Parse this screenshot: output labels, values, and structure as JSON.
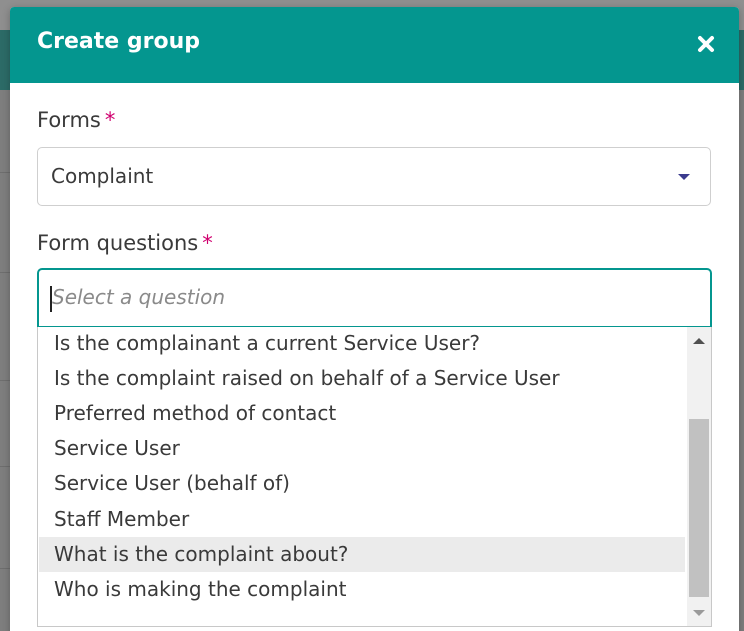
{
  "modal": {
    "title": "Create group",
    "close_icon": "close-icon"
  },
  "forms": {
    "label": "Forms",
    "required_marker": "*",
    "selected_value": "Complaint"
  },
  "form_questions": {
    "label": "Form questions",
    "required_marker": "*",
    "placeholder": "Select a question",
    "options": [
      "Is the complainant a current Service User?",
      "Is the complaint raised on behalf of a Service User",
      "Preferred method of contact",
      "Service User",
      "Service User (behalf of)",
      "Staff Member",
      "What is the complaint about?",
      "Who is making the complaint"
    ],
    "hovered_option": "What is the complaint about?"
  },
  "colors": {
    "header": "#04968f",
    "focus_border": "#04968f",
    "required": "#d0006f"
  }
}
